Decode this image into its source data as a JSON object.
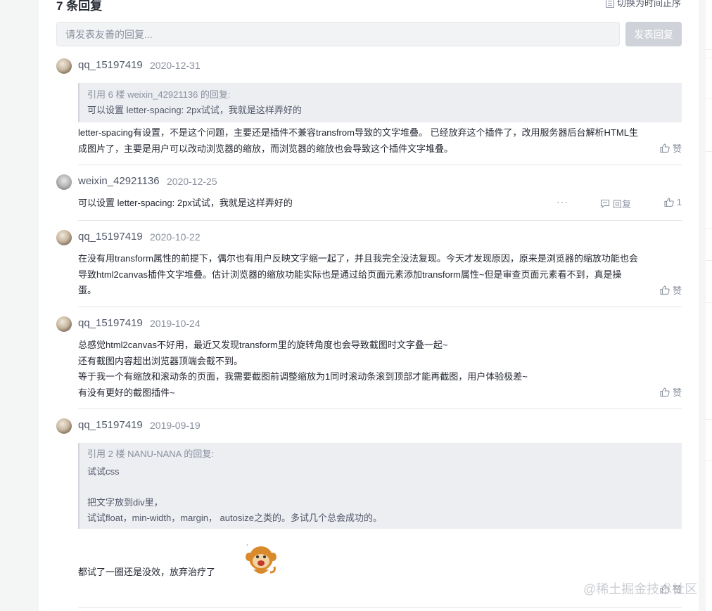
{
  "header": {
    "title": "7 条回复",
    "sort_label": "切换为时间正序"
  },
  "input": {
    "placeholder": "请发表友善的回复...",
    "send_label": "发表回复"
  },
  "comments": [
    {
      "user": "qq_15197419",
      "date": "2020-12-31",
      "quote": {
        "head": "引用 6 楼 weixin_42921136 的回复:",
        "lines": [
          "可以设置 letter-spacing: 2px试试，我就是这样弄好的"
        ]
      },
      "lines": [
        "letter-spacing有设置，不是这个问题，主要还是插件不兼容transfrom导致的文字堆叠。 已经放弃这个插件了，改用服务器后台解析HTML生",
        "成图片了，主要是用户可以改动浏览器的缩放，而浏览器的缩放也会导致这个插件文字堆叠。"
      ],
      "like_label": "赞"
    },
    {
      "user": "weixin_42921136",
      "date": "2020-12-25",
      "lines": [
        "可以设置 letter-spacing: 2px试试，我就是这样弄好的"
      ],
      "more_label": "···",
      "reply_label": "回复",
      "like_label": "1"
    },
    {
      "user": "qq_15197419",
      "date": "2020-10-22",
      "lines": [
        "在没有用transform属性的前提下，偶尔也有用户反映文字缩一起了，并且我完全没法复现。今天才发现原因，原来是浏览器的缩放功能也会",
        "导致html2canvas插件文字堆叠。估计浏览器的缩放功能实际也是通过给页面元素添加transform属性~但是审查页面元素看不到，真是操",
        "蛋。"
      ],
      "like_label": "赞"
    },
    {
      "user": "qq_15197419",
      "date": "2019-10-24",
      "lines": [
        "总感觉html2canvas不好用，最近又发现transform里的旋转角度也会导致截图时文字叠一起~",
        "还有截图内容超出浏览器顶端会截不到。",
        "等于我一个有缩放和滚动条的页面，我需要截图前调整缩放为1同时滚动条滚到顶部才能再截图，用户体验极差~",
        "有没有更好的截图插件~"
      ],
      "like_label": "赞"
    },
    {
      "user": "qq_15197419",
      "date": "2019-09-19",
      "quote": {
        "head": "引用 2 楼 NANU-NANA 的回复:",
        "lines": [
          "试试css",
          "",
          "把文字放到div里，",
          "试试float，min-width，margin， autosize之类的。多试几个总会成功的。"
        ]
      },
      "lines": [
        "都试了一圈还是没效，放弃治疗了"
      ],
      "like_label": "赞"
    }
  ],
  "watermark": "@稀土掘金技术社区",
  "colors": {
    "accent_disabled": "#cfd2d9",
    "quote_bg": "#eceef2",
    "muted_text": "#8a919f"
  }
}
